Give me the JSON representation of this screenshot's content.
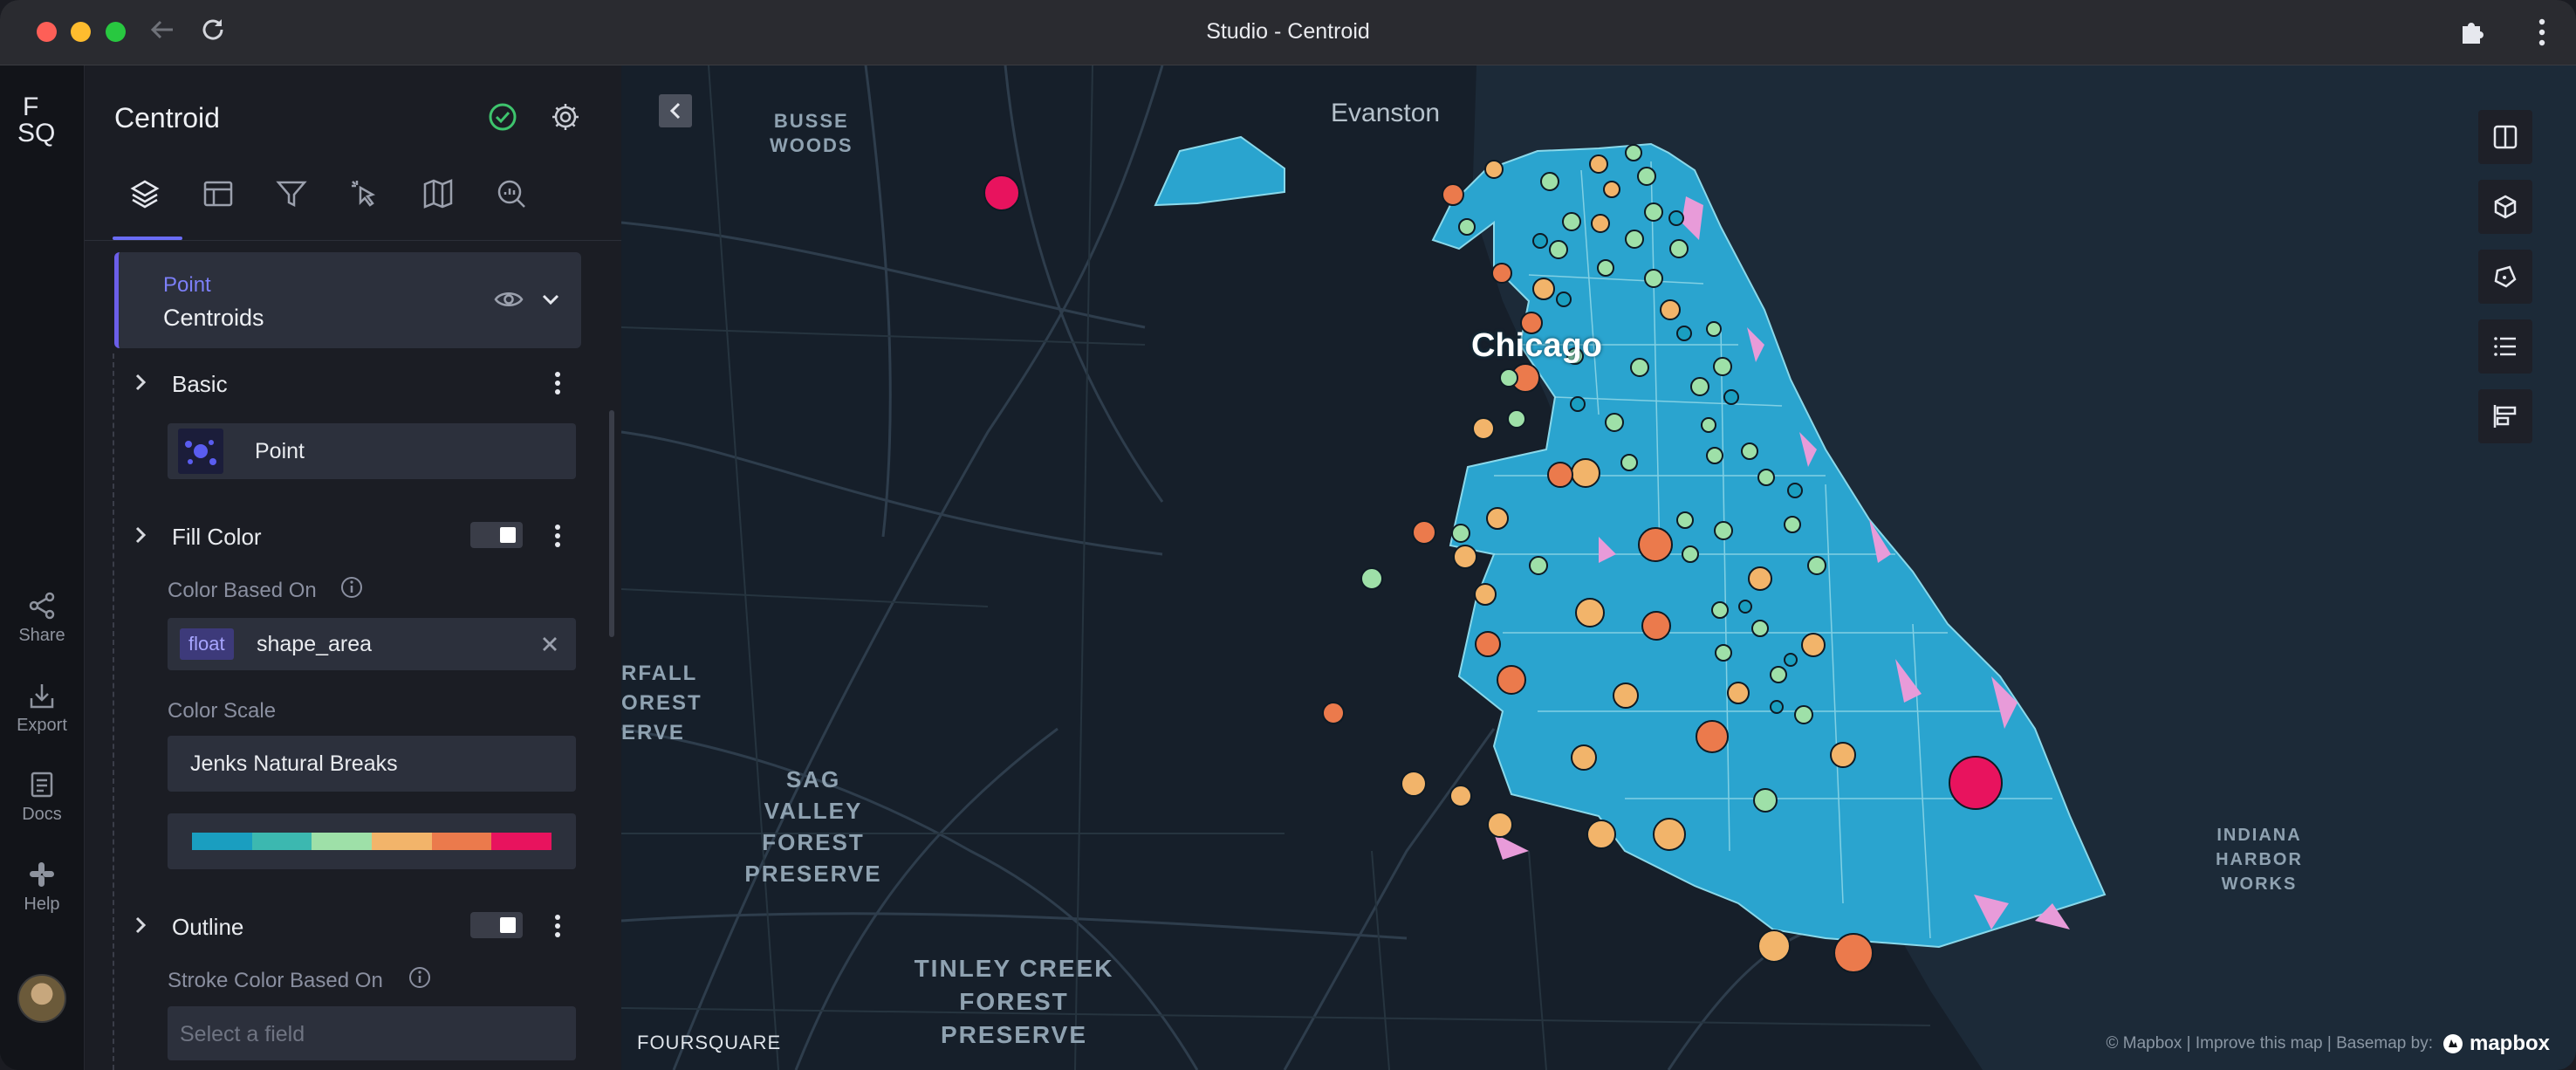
{
  "window": {
    "title": "Studio - Centroid"
  },
  "rail": {
    "logo_line1": "F",
    "logo_line2": "SQ",
    "items": [
      {
        "label": "Share",
        "icon": "share-icon"
      },
      {
        "label": "Export",
        "icon": "export-icon"
      },
      {
        "label": "Docs",
        "icon": "docs-icon"
      },
      {
        "label": "Help",
        "icon": "help-icon"
      }
    ]
  },
  "panel": {
    "title": "Centroid",
    "tabs": [
      "layers-tab",
      "interactions-tab",
      "filters-tab",
      "interactions-pointer-tab",
      "basemap-tab",
      "search-tab"
    ],
    "layer": {
      "type": "Point",
      "name": "Centroids"
    },
    "sections": {
      "basic": "Basic",
      "basic_value": "Point",
      "fill_color": "Fill Color",
      "color_based_on_label": "Color Based On",
      "field_type": "float",
      "field_name": "shape_area",
      "color_scale_label": "Color Scale",
      "color_scale_value": "Jenks Natural Breaks",
      "outline": "Outline",
      "stroke_label": "Stroke Color Based On",
      "stroke_placeholder": "Select a field"
    },
    "palette": [
      "#1a9ec0",
      "#3cb8b0",
      "#9ee0a8",
      "#f2b46a",
      "#eb7a4c",
      "#e8135e"
    ]
  },
  "map": {
    "labels": {
      "evanston": "Evanston",
      "busse": [
        "BUSSE",
        "WOODS"
      ],
      "chicago": "Chicago",
      "sag": [
        "SAG VALLEY",
        "FOREST",
        "PRESERVE"
      ],
      "tinley": [
        "TINLEY CREEK",
        "FOREST",
        "PRESERVE"
      ],
      "indiana": [
        "INDIANA",
        "HARBOR",
        "WORKS"
      ],
      "rfall": [
        "RFALL",
        "OREST",
        "ERVE"
      ]
    },
    "watermark": "FOURSQUARE",
    "attribution": "© Mapbox | Improve this map | Basemap by:",
    "mapbox": "mapbox",
    "colors": {
      "land": "#161f2a",
      "water": "#1c2a38",
      "region": "#2aa4cf",
      "accent": "#eb3c7a"
    }
  }
}
